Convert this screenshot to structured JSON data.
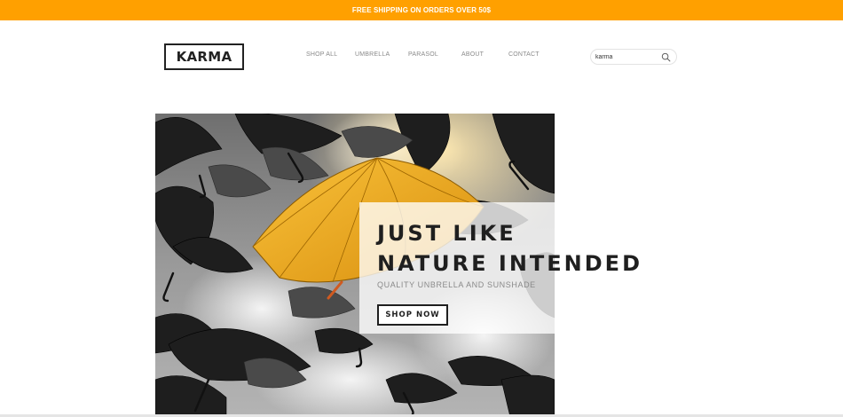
{
  "promo": {
    "text": "FREE SHIPPING ON ORDERS OVER 50$"
  },
  "header": {
    "logo": "KARMA",
    "nav": [
      {
        "label": "SHOP ALL"
      },
      {
        "label": "UMBRELLA"
      },
      {
        "label": "PARASOL"
      },
      {
        "label": "ABOUT"
      },
      {
        "label": "CONTACT"
      }
    ],
    "search": {
      "value": "karma",
      "icon": "search-icon"
    }
  },
  "hero": {
    "heading_line1": "JUST LIKE",
    "heading_line2": "NATURE INTENDED",
    "subheading": "QUALITY UNBRELLA AND SUNSHADE",
    "cta": "SHOP NOW"
  },
  "colors": {
    "promo_bar": "#ffa000",
    "text_dark": "#1f1f1f",
    "nav_text": "#8a8a8a",
    "accent_umbrella": "#f2a81c"
  }
}
